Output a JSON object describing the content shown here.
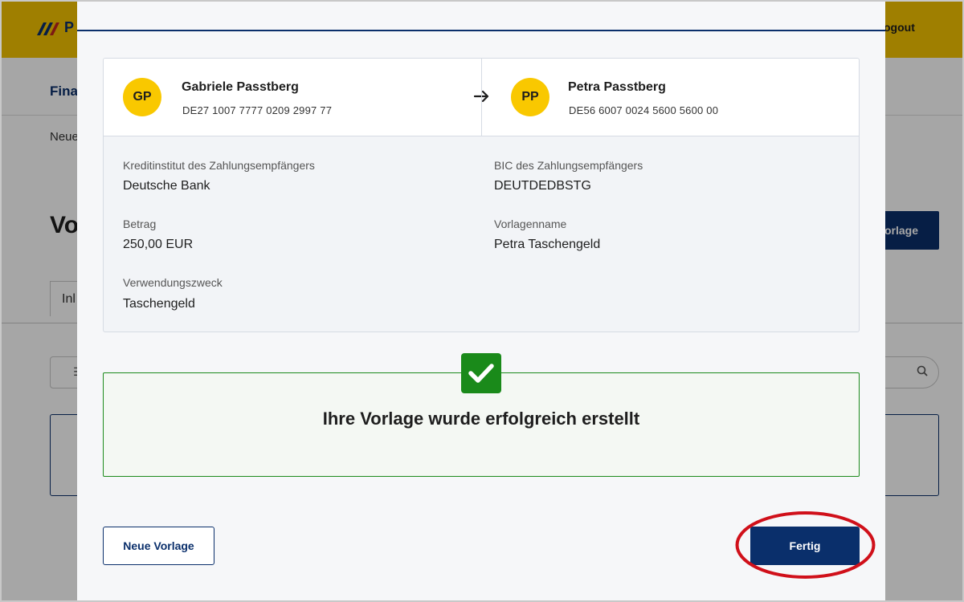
{
  "background": {
    "logo_text": "P",
    "logout_label": "ogout",
    "nav_label": "Fina",
    "breadcrumb": "Neue",
    "page_title": "Vo",
    "action_button_label": "orlage",
    "tab_label": "Inl"
  },
  "transfer": {
    "sender": {
      "initials": "GP",
      "name": "Gabriele Passtberg",
      "iban": "DE27 1007 7777 0209 2997 77"
    },
    "recipient": {
      "initials": "PP",
      "name": "Petra Passtberg",
      "iban": "DE56 6007 0024 5600 5600 00"
    },
    "arrow_icon": "arrow-right-icon"
  },
  "details": {
    "bank_label": "Kreditinstitut des Zahlungsempfängers",
    "bank_value": "Deutsche Bank",
    "bic_label": "BIC des Zahlungsempfängers",
    "bic_value": "DEUTDEDBSTG",
    "amount_label": "Betrag",
    "amount_value": "250,00 EUR",
    "template_name_label": "Vorlagenname",
    "template_name_value": "Petra Taschengeld",
    "purpose_label": "Verwendungszweck",
    "purpose_value": "Taschengeld"
  },
  "success": {
    "icon": "checkmark-icon",
    "message": "Ihre Vorlage wurde erfolgreich erstellt"
  },
  "actions": {
    "new_template_label": "Neue Vorlage",
    "done_label": "Fertig"
  },
  "colors": {
    "brand_yellow": "#f5c400",
    "brand_navy": "#0a2f6b",
    "success_green": "#1a8a1a",
    "highlight_red": "#d0101a"
  }
}
